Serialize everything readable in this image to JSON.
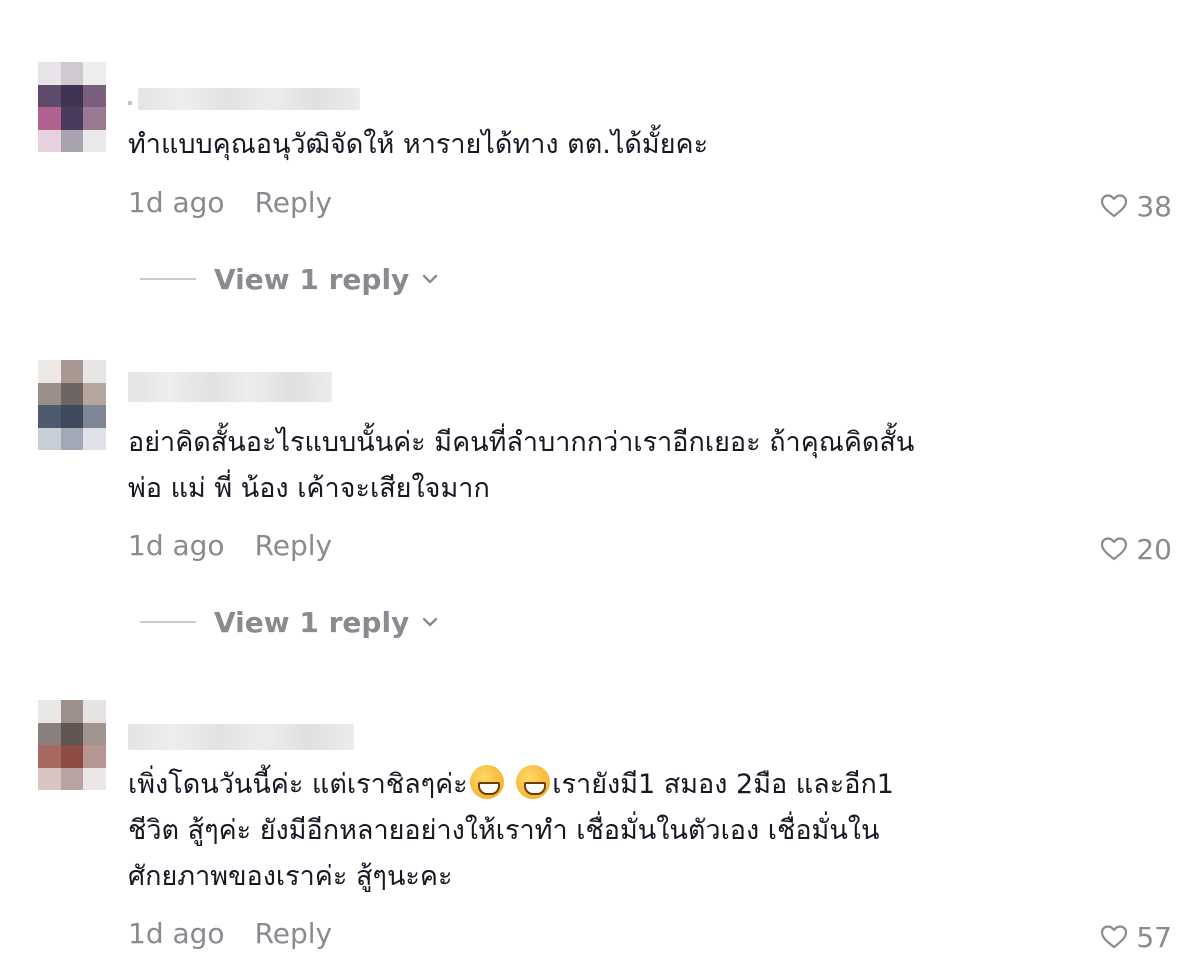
{
  "comments": [
    {
      "text": "ทำแบบคุณอนุวัฒิจัดให้ หารายได้ทาง ตต.ได้มั้ยคะ",
      "time": "1d ago",
      "reply_label": "Reply",
      "likes": "38",
      "view_replies": "View 1 reply"
    },
    {
      "text": "อย่าคิดสั้นอะไรแบบนั้นค่ะ มีคนที่ลำบากกว่าเราอีกเยอะ ถ้าคุณคิดสั้น\nพ่อ แม่ พี่ น้อง เค้าจะเสียใจมาก",
      "time": "1d ago",
      "reply_label": "Reply",
      "likes": "20",
      "view_replies": "View 1 reply"
    },
    {
      "text_before_emoji": "เพิ่งโดนวันนี้ค่ะ แต่เราชิลๆค่ะ",
      "emoji_name": "grinning-face-emoji",
      "text_after_emoji": "เรายังมี1 สมอง 2มือ และอีก1",
      "text_rest": "ชีวิต สู้ๆค่ะ ยังมีอีกหลายอย่างให้เราทำ เชื่อมั่นในตัวเอง เชื่อมั่นใน\nศักยภาพของเราค่ะ สู้ๆนะคะ",
      "time": "1d ago",
      "reply_label": "Reply",
      "likes": "57"
    }
  ],
  "icons": {
    "like": "heart-outline-icon",
    "expand": "chevron-down-icon"
  },
  "colors": {
    "text": "#161823",
    "secondary": "#8a8b91"
  }
}
